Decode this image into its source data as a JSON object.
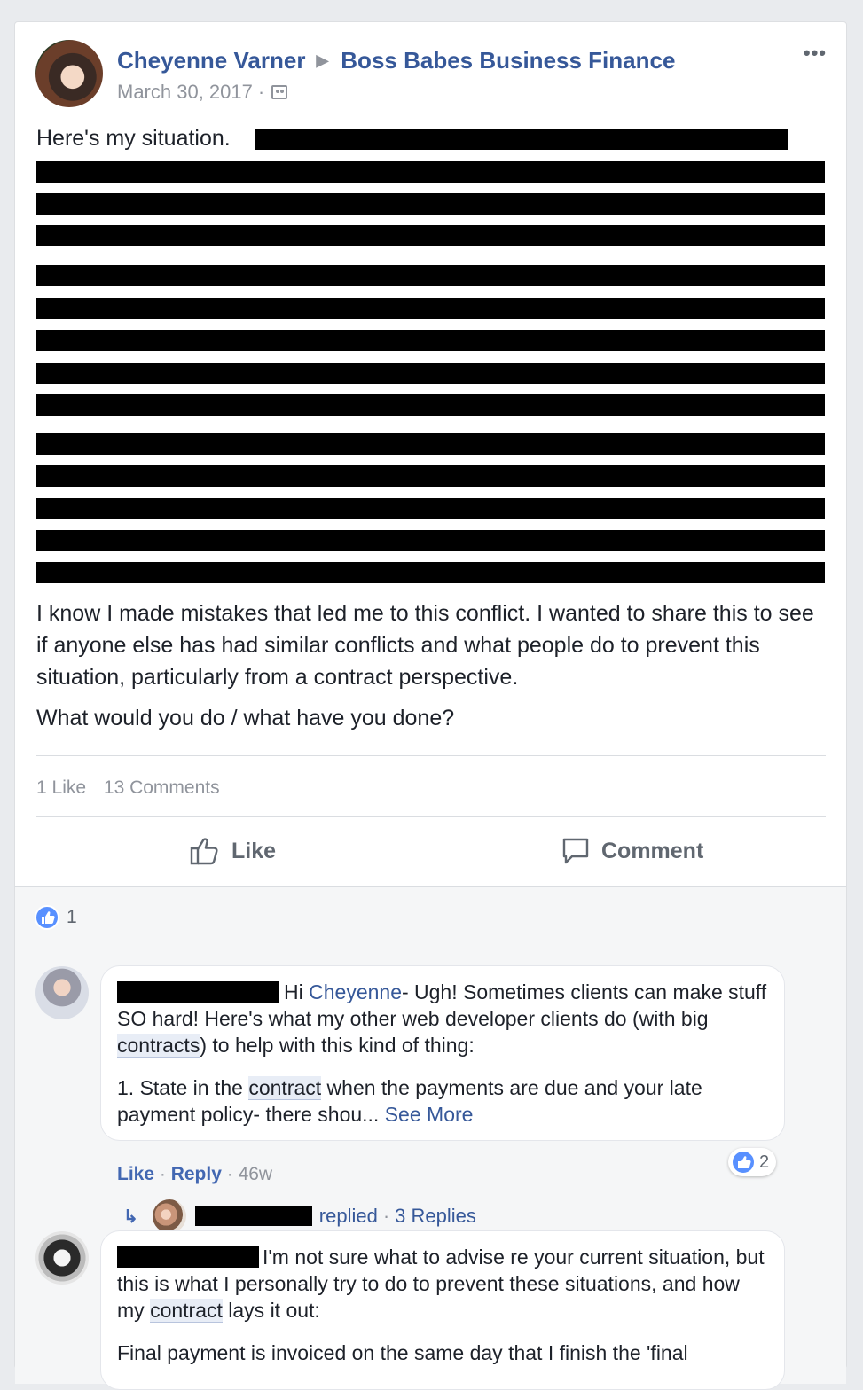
{
  "post": {
    "author": "Cheyenne Varner",
    "group": "Boss Babes Business Finance",
    "date": "March 30, 2017",
    "separator": "·",
    "more_icon": "more-dots-icon",
    "intro": "Here's my situation.",
    "paragraph_1": "I know I made mistakes that led me to this conflict. I wanted to share this to see if anyone else has had similar conflicts and what people do to prevent this situation, particularly from a contract perspective.",
    "paragraph_2": "What would you do / what have you done?",
    "likes_count": "1 Like",
    "comments_count": "13 Comments"
  },
  "actions": {
    "like_label": "Like",
    "comment_label": "Comment"
  },
  "reactions": {
    "count": "1"
  },
  "comments": [
    {
      "p1_a": "Hi ",
      "p1_name": "Cheyenne",
      "p1_b": "- Ugh! Sometimes clients can make stuff SO hard! Here's what my other web developer clients do (with big ",
      "p1_link": "contracts",
      "p1_c": ") to help with this kind of thing:",
      "p2_a": "1. State in the ",
      "p2_link": "contract",
      "p2_b": " when the payments are due and your late payment policy- there shou...",
      "see_more": "See More",
      "like": "Like",
      "reply": "Reply",
      "time": "46w",
      "reaction_count": "2",
      "replied_text": "replied",
      "replies": "3 Replies"
    },
    {
      "p1_a": "I'm not sure what to advise re your current situation, but this is what I personally try to do to prevent these situations, and how my ",
      "p1_link": "contract",
      "p1_b": " lays it out:",
      "p2_partial": "Final payment is invoiced on the same day that I finish the 'final"
    }
  ],
  "colors": {
    "link": "#365899",
    "like_blue": "#5890ff",
    "muted": "#90949c"
  }
}
